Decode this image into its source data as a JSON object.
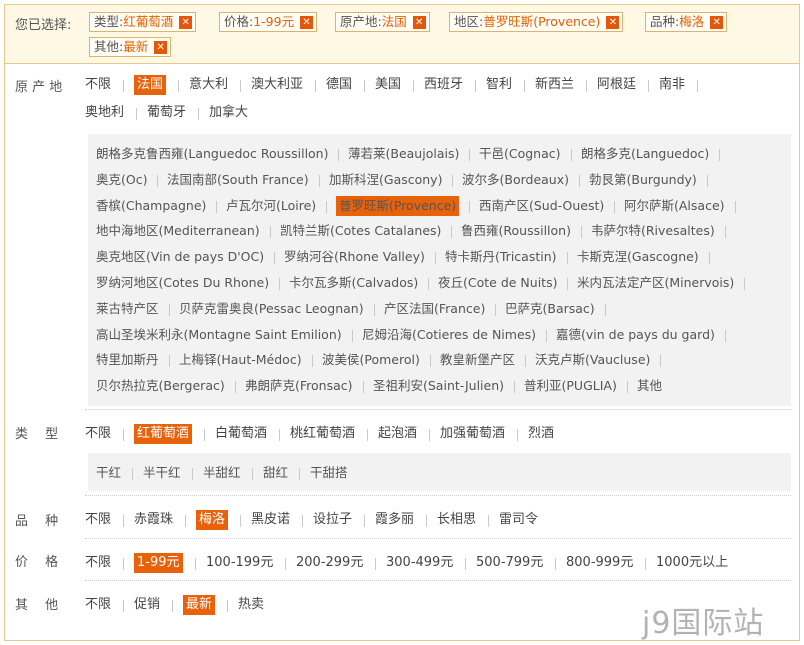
{
  "selected": {
    "label": "您已选择:",
    "chips": [
      {
        "key": "类型:",
        "value": "红葡萄酒"
      },
      {
        "key": "价格:",
        "value": "1-99元"
      },
      {
        "key": "原产地:",
        "value": "法国"
      },
      {
        "key": "地区:",
        "value": "普罗旺斯(Provence)"
      },
      {
        "key": "品种:",
        "value": "梅洛"
      },
      {
        "key": "其他:",
        "value": "最新"
      }
    ],
    "remove_icon": "close-x-icon"
  },
  "origin": {
    "label": "原产地",
    "options": [
      "不限",
      "法国",
      "意大利",
      "澳大利亚",
      "德国",
      "美国",
      "西班牙",
      "智利",
      "新西兰",
      "阿根廷",
      "南非",
      "奥地利",
      "葡萄牙",
      "加拿大"
    ],
    "selected": "法国"
  },
  "region": {
    "options": [
      "朗格多克鲁西雍(Languedoc Roussillon)",
      "薄若莱(Beaujolais)",
      "干邑(Cognac)",
      "朗格多克(Languedoc)",
      "奥克(Oc)",
      "法国南部(South France)",
      "加斯科涅(Gascony)",
      "波尔多(Bordeaux)",
      "勃艮第(Burgundy)",
      "香槟(Champagne)",
      "卢瓦尔河(Loire)",
      "普罗旺斯(Provence)",
      "西南产区(Sud-Ouest)",
      "阿尔萨斯(Alsace)",
      "地中海地区(Mediterranean)",
      "凯特兰斯(Cotes Catalanes)",
      "鲁西雍(Roussillon)",
      "韦萨尔特(Rivesaltes)",
      "奥克地区(Vin de pays D'OC)",
      "罗纳河谷(Rhone Valley)",
      "特卡斯丹(Tricastin)",
      "卡斯克涅(Gascogne)",
      "罗纳河地区(Cotes Du Rhone)",
      "卡尔瓦多斯(Calvados)",
      "夜丘(Cote de Nuits)",
      "米内瓦法定产区(Minervois)",
      "莱古特产区",
      "贝萨克雷奥良(Pessac Leognan)",
      "产区法国(France)",
      "巴萨克(Barsac)",
      "高山圣埃米利永(Montagne Saint Emilion)",
      "尼姆沿海(Cotieres de Nimes)",
      "嘉德(vin de pays du gard)",
      "特里加斯丹",
      "上梅铎(Haut-Médoc)",
      "波美侯(Pomerol)",
      "教皇新堡产区",
      "沃克卢斯(Vaucluse)",
      "贝尔热拉克(Bergerac)",
      "弗朗萨克(Fronsac)",
      "圣祖利安(Saint-Julien)",
      "普利亚(PUGLIA)",
      "其他"
    ],
    "selected": "普罗旺斯(Provence)"
  },
  "type": {
    "label": "类型",
    "options": [
      "不限",
      "红葡萄酒",
      "白葡萄酒",
      "桃红葡萄酒",
      "起泡酒",
      "加强葡萄酒",
      "烈酒"
    ],
    "selected": "红葡萄酒",
    "sub_options": [
      "干红",
      "半干红",
      "半甜红",
      "甜红",
      "干甜搭"
    ]
  },
  "variety": {
    "label": "品种",
    "options": [
      "不限",
      "赤霞珠",
      "梅洛",
      "黑皮诺",
      "设拉子",
      "霞多丽",
      "长相思",
      "雷司令"
    ],
    "selected": "梅洛"
  },
  "price": {
    "label": "价格",
    "options": [
      "不限",
      "1-99元",
      "100-199元",
      "200-299元",
      "300-499元",
      "500-799元",
      "800-999元",
      "1000元以上"
    ],
    "selected": "1-99元"
  },
  "other": {
    "label": "其他",
    "options": [
      "不限",
      "促销",
      "最新",
      "热卖"
    ],
    "selected": "最新"
  },
  "watermark": "j9国际站"
}
